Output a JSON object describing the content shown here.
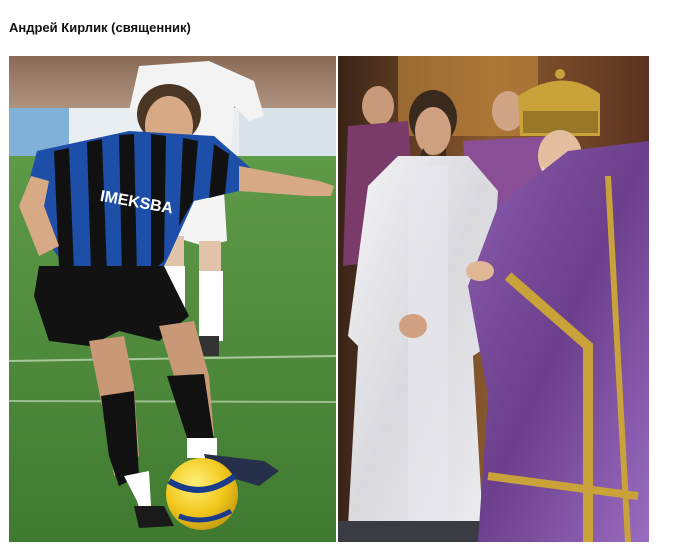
{
  "page": {
    "title": "Андрей Кирлик (священник)"
  },
  "left_photo": {
    "jersey_text": "IMEKSBA",
    "colors": {
      "grass": "#4f8a3e",
      "jersey_blue": "#1d4fa8",
      "jersey_black": "#111111",
      "ball_yellow": "#f2c81c",
      "ball_blue": "#1a3a8c"
    }
  },
  "right_photo": {
    "colors": {
      "vestment_white": "#e6e6ea",
      "vestment_purple": "#7b4e9c",
      "gold": "#c9a23a",
      "background": "#6a3a22"
    }
  }
}
